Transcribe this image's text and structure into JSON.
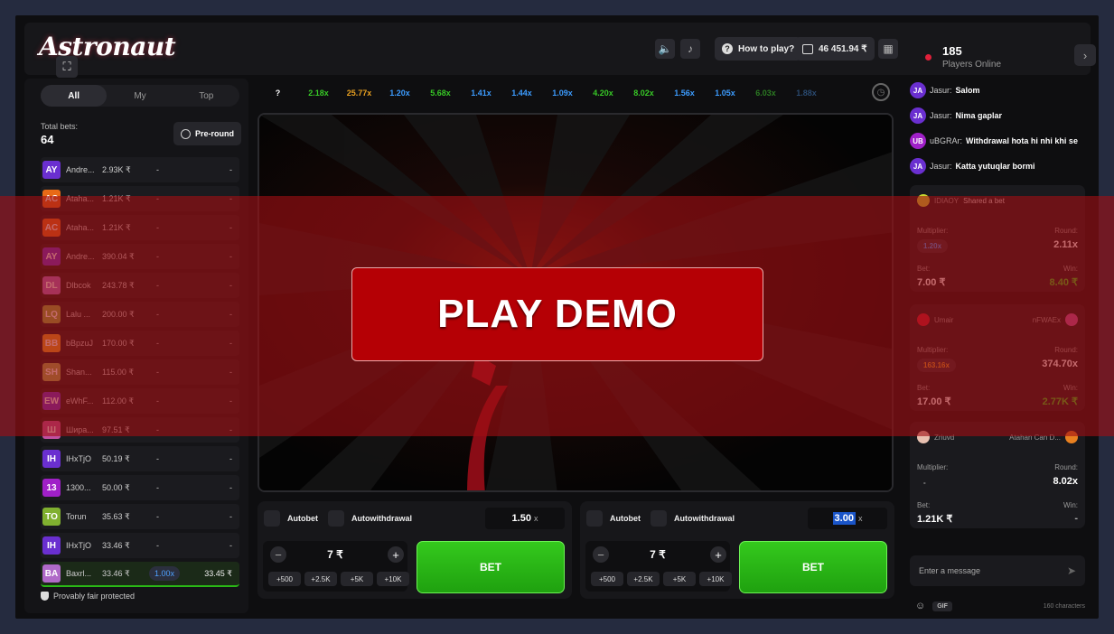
{
  "app": {
    "logo": "Astronaut",
    "how_to_play": "How to play?",
    "balance": "46 451.94 ₹",
    "players_online_count": "185",
    "players_online_label": "Players Online"
  },
  "left": {
    "tabs": [
      "All",
      "My",
      "Top"
    ],
    "total_bets_label": "Total bets:",
    "total_bets_count": "64",
    "preround_label": "Pre-round",
    "fair_label": "Provably fair protected",
    "bets": [
      {
        "av": "AY",
        "color": "#6a2fd0",
        "name": "Andre...",
        "amount": "2.93K ₹",
        "mult": "-",
        "win": "-"
      },
      {
        "av": "AC",
        "color": "#e86a16",
        "name": "Ataha...",
        "amount": "1.21K ₹",
        "mult": "-",
        "win": "-"
      },
      {
        "av": "AC",
        "color": "#e86a16",
        "name": "Ataha...",
        "amount": "1.21K ₹",
        "mult": "-",
        "win": "-"
      },
      {
        "av": "AY",
        "color": "#6a2fd0",
        "name": "Andre...",
        "amount": "390.04 ₹",
        "mult": "-",
        "win": "-"
      },
      {
        "av": "DL",
        "color": "#b06ac8",
        "name": "Dlbcok",
        "amount": "243.78 ₹",
        "mult": "-",
        "win": "-"
      },
      {
        "av": "LQ",
        "color": "#8fb040",
        "name": "Lalu ...",
        "amount": "200.00 ₹",
        "mult": "-",
        "win": "-"
      },
      {
        "av": "BB",
        "color": "#e8a020",
        "name": "bBpzuJ",
        "amount": "170.00 ₹",
        "mult": "-",
        "win": "-"
      },
      {
        "av": "SH",
        "color": "#a0b050",
        "name": "Shan...",
        "amount": "115.00 ₹",
        "mult": "-",
        "win": "-"
      },
      {
        "av": "EW",
        "color": "#6a2fd0",
        "name": "eWhF...",
        "amount": "112.00 ₹",
        "mult": "-",
        "win": "-"
      },
      {
        "av": "Ш",
        "color": "#c050a0",
        "name": "Шира...",
        "amount": "97.51 ₹",
        "mult": "-",
        "win": "-"
      },
      {
        "av": "IH",
        "color": "#6a2fd0",
        "name": "IHxTjO",
        "amount": "50.19 ₹",
        "mult": "-",
        "win": "-"
      },
      {
        "av": "13",
        "color": "#a020c8",
        "name": "1300...",
        "amount": "50.00 ₹",
        "mult": "-",
        "win": "-"
      },
      {
        "av": "TO",
        "color": "#80b030",
        "name": "Torun",
        "amount": "35.63 ₹",
        "mult": "-",
        "win": "-"
      },
      {
        "av": "IH",
        "color": "#6a2fd0",
        "name": "IHxTjO",
        "amount": "33.46 ₹",
        "mult": "-",
        "win": "-"
      },
      {
        "av": "BA",
        "color": "#b06ac8",
        "name": "Baxrl...",
        "amount": "33.46 ₹",
        "mult": "1.00x",
        "win": "33.45 ₹",
        "winrow": true
      }
    ]
  },
  "history": [
    {
      "v": "?",
      "c": "#ffffff"
    },
    {
      "v": "2.18x",
      "c": "#37c826"
    },
    {
      "v": "25.77x",
      "c": "#e8a020"
    },
    {
      "v": "1.20x",
      "c": "#3c9cff"
    },
    {
      "v": "5.68x",
      "c": "#37c826"
    },
    {
      "v": "1.41x",
      "c": "#3c9cff"
    },
    {
      "v": "1.44x",
      "c": "#3c9cff"
    },
    {
      "v": "1.09x",
      "c": "#3c9cff"
    },
    {
      "v": "4.20x",
      "c": "#37c826"
    },
    {
      "v": "8.02x",
      "c": "#37c826"
    },
    {
      "v": "1.56x",
      "c": "#3c9cff"
    },
    {
      "v": "1.05x",
      "c": "#3c9cff"
    },
    {
      "v": "6.03x",
      "c": "#2b7a22"
    },
    {
      "v": "1.88x",
      "c": "#2a4a70"
    }
  ],
  "bet_panels": [
    {
      "autobet": "Autobet",
      "autowithdrawal": "Autowithdrawal",
      "mult": "1.50",
      "mult_suffix": "x",
      "amount": "7 ₹",
      "chips": [
        "+500",
        "+2.5K",
        "+5K",
        "+10K"
      ],
      "bet_label": "BET"
    },
    {
      "autobet": "Autobet",
      "autowithdrawal": "Autowithdrawal",
      "mult": "3.00",
      "mult_suffix": "x",
      "amount": "7 ₹",
      "chips": [
        "+500",
        "+2.5K",
        "+5K",
        "+10K"
      ],
      "bet_label": "BET"
    }
  ],
  "chat": {
    "messages": [
      {
        "av": "JA",
        "name": "Jasur:",
        "text": "Salom"
      },
      {
        "av": "JA",
        "name": "Jasur:",
        "text": "Nima gaplar"
      },
      {
        "av": "UB",
        "name": "uBGRAr:",
        "text": "Withdrawal hota hi nhi khi se"
      },
      {
        "av": "JA",
        "name": "Jasur:",
        "text": "Katta yutuqlar bormi"
      }
    ],
    "cards": [
      {
        "user": "IDIAOY",
        "action": "Shared a bet",
        "user2": "",
        "mult_label": "Multiplier:",
        "mult": "1.20x",
        "mult_color": "#3c9cff",
        "round_label": "Round:",
        "round": "2.11x",
        "bet_label": "Bet:",
        "bet": "7.00 ₹",
        "win_label": "Win:",
        "win": "8.40 ₹"
      },
      {
        "user": "Umair",
        "action": "",
        "user2": "nFWAEx",
        "mult_label": "Multiplier:",
        "mult": "163.16x",
        "mult_color": "#e8a020",
        "round_label": "Round:",
        "round": "374.70x",
        "bet_label": "Bet:",
        "bet": "17.00 ₹",
        "win_label": "Win:",
        "win": "2.77K ₹"
      },
      {
        "user": "Zriuvd",
        "action": "",
        "user2": "Atahan Can D...",
        "mult_label": "Multiplier:",
        "mult": "-",
        "mult_color": "#aaaaaa",
        "round_label": "Round:",
        "round": "8.02x",
        "bet_label": "Bet:",
        "bet": "1.21K ₹",
        "win_label": "Win:",
        "win": "-"
      }
    ],
    "input_placeholder": "Enter a message",
    "gif_label": "GIF",
    "char_limit": "160 characters"
  },
  "overlay": {
    "play_demo": "PLAY DEMO"
  }
}
